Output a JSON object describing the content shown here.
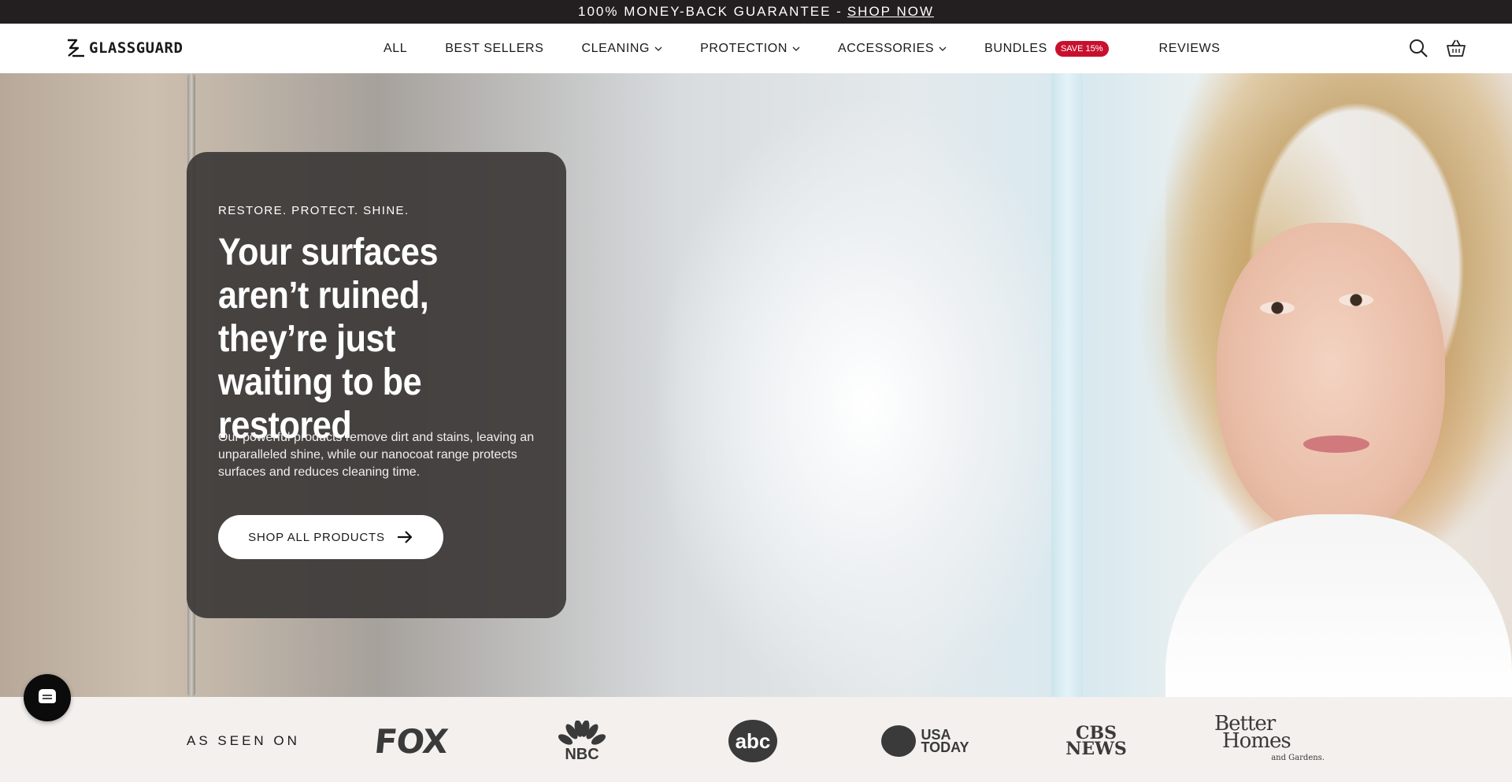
{
  "announcement": {
    "text": "100% MONEY-BACK GUARANTEE -",
    "link": "SHOP NOW"
  },
  "header": {
    "logo": "GLASSGUARD",
    "nav": [
      {
        "label": "ALL",
        "dropdown": false
      },
      {
        "label": "BEST SELLERS",
        "dropdown": false
      },
      {
        "label": "CLEANING",
        "dropdown": true
      },
      {
        "label": "PROTECTION",
        "dropdown": true
      },
      {
        "label": "ACCESSORIES",
        "dropdown": true
      },
      {
        "label": "BUNDLES",
        "dropdown": false,
        "badge": "SAVE 15%"
      },
      {
        "label": "REVIEWS",
        "dropdown": false
      }
    ],
    "icons": [
      "search-icon",
      "basket-icon"
    ]
  },
  "hero": {
    "eyebrow": "RESTORE. PROTECT. SHINE.",
    "headline": "Your surfaces aren’t ruined, they’re just waiting to be restored",
    "body": "Our powerful products remove dirt and stains, leaving an unparalleled shine, while our nanocoat range protects surfaces and reduces cleaning time.",
    "cta": "SHOP ALL PRODUCTS"
  },
  "seen_on": {
    "label": "AS SEEN ON",
    "logos": {
      "fox": "FOX",
      "nbc": "NBC",
      "abc": "abc",
      "usa_today_1": "USA",
      "usa_today_2": "TODAY",
      "cbs_1": "CBS",
      "cbs_2": "NEWS",
      "bhg_1": "Better",
      "bhg_2": "Homes",
      "bhg_3": "and Gardens."
    }
  },
  "colors": {
    "announcement_bg": "#231f20",
    "badge": "#c8102e",
    "card_bg": "#3c3837",
    "press_bg": "#f3f0ed"
  }
}
